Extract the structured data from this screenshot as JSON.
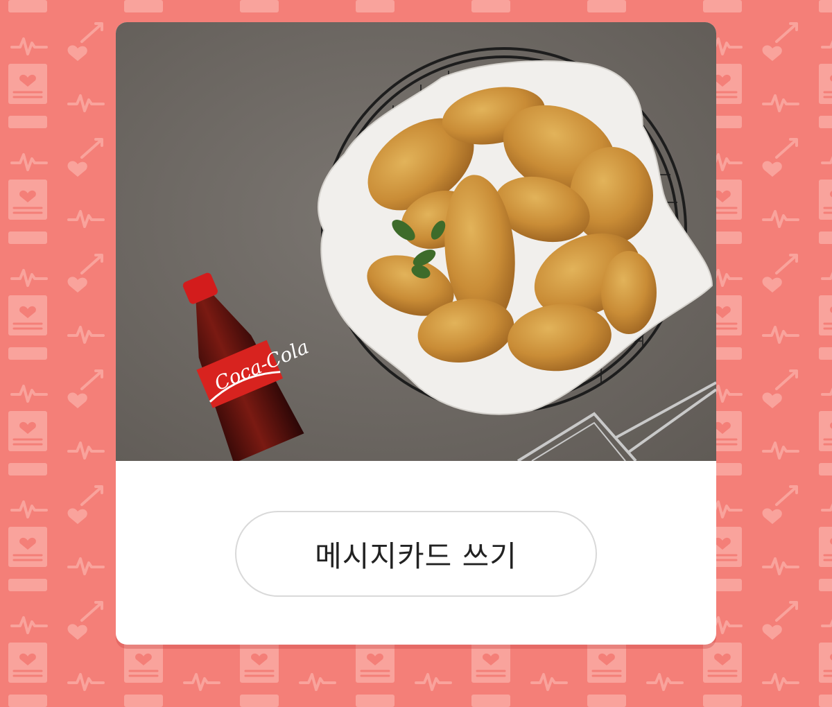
{
  "background": {
    "color": "#f47f78",
    "pattern_color": "#f9a39c",
    "pattern_icons": [
      "heart-card-icon",
      "heartbeat-line-icon",
      "heart-arrow-icon"
    ]
  },
  "card": {
    "background": "#ffffff",
    "image": {
      "description_icon": "fried-chicken-photo",
      "bottle_label_text": "Coca-Cola"
    },
    "action_button": {
      "label": "메시지카드 쓰기",
      "border_color": "#d9d9d9"
    }
  }
}
